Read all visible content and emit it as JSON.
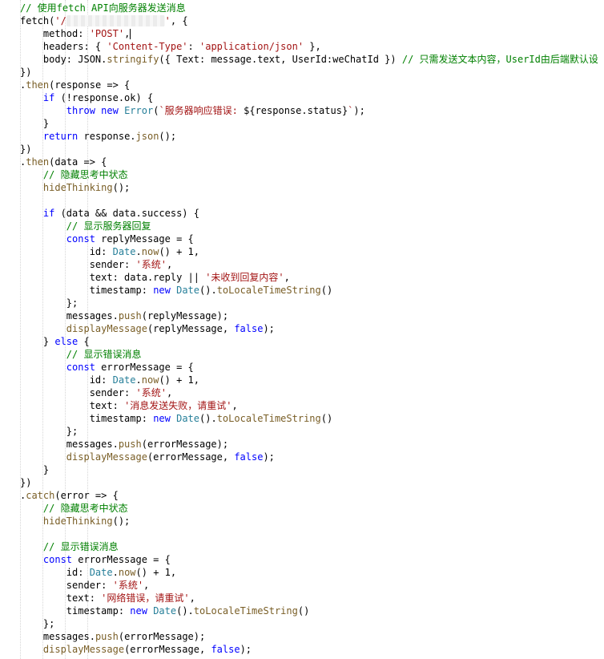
{
  "editor": {
    "colors": {
      "background": "#ffffff",
      "comment": "#008000",
      "keyword": "#0000ff",
      "string": "#a31515",
      "builtin": "#267f99",
      "function": "#795e26",
      "plain": "#000000"
    },
    "cursor_line": 3,
    "lines": [
      {
        "indent": 0,
        "tokens": [
          {
            "t": "comment",
            "s": "// 使用fetch API向服务器发送消息"
          }
        ]
      },
      {
        "indent": 0,
        "tokens": [
          {
            "t": "plain",
            "s": "fetch("
          },
          {
            "t": "string",
            "s": "'/"
          },
          {
            "t": "redacted",
            "s": "xxxxxxxxxxxxxxxxx"
          },
          {
            "t": "string",
            "s": "'"
          },
          {
            "t": "plain",
            "s": ", {"
          }
        ]
      },
      {
        "indent": 1,
        "tokens": [
          {
            "t": "plain",
            "s": "method: "
          },
          {
            "t": "string",
            "s": "'POST'"
          },
          {
            "t": "plain",
            "s": ","
          }
        ]
      },
      {
        "indent": 1,
        "tokens": [
          {
            "t": "plain",
            "s": "headers: { "
          },
          {
            "t": "string",
            "s": "'Content-Type'"
          },
          {
            "t": "plain",
            "s": ": "
          },
          {
            "t": "string",
            "s": "'application/json'"
          },
          {
            "t": "plain",
            "s": " },"
          }
        ]
      },
      {
        "indent": 1,
        "tokens": [
          {
            "t": "plain",
            "s": "body: JSON."
          },
          {
            "t": "func",
            "s": "stringify"
          },
          {
            "t": "plain",
            "s": "({ Text: message.text, UserId:weChatId }) "
          },
          {
            "t": "comment",
            "s": "// 只需发送文本内容，UserId由后端默认设"
          }
        ]
      },
      {
        "indent": 0,
        "tokens": [
          {
            "t": "plain",
            "s": "})"
          }
        ]
      },
      {
        "indent": 0,
        "tokens": [
          {
            "t": "plain",
            "s": "."
          },
          {
            "t": "func",
            "s": "then"
          },
          {
            "t": "plain",
            "s": "(response => {"
          }
        ]
      },
      {
        "indent": 1,
        "tokens": [
          {
            "t": "keyword",
            "s": "if"
          },
          {
            "t": "plain",
            "s": " (!response.ok) {"
          }
        ]
      },
      {
        "indent": 2,
        "tokens": [
          {
            "t": "keyword",
            "s": "throw"
          },
          {
            "t": "plain",
            "s": " "
          },
          {
            "t": "keyword",
            "s": "new"
          },
          {
            "t": "plain",
            "s": " "
          },
          {
            "t": "builtin",
            "s": "Error"
          },
          {
            "t": "plain",
            "s": "("
          },
          {
            "t": "string",
            "s": "`服务器响应错误: "
          },
          {
            "t": "plain",
            "s": "${response.status}"
          },
          {
            "t": "string",
            "s": "`"
          },
          {
            "t": "plain",
            "s": ");"
          }
        ]
      },
      {
        "indent": 1,
        "tokens": [
          {
            "t": "plain",
            "s": "}"
          }
        ]
      },
      {
        "indent": 1,
        "tokens": [
          {
            "t": "keyword",
            "s": "return"
          },
          {
            "t": "plain",
            "s": " response."
          },
          {
            "t": "func",
            "s": "json"
          },
          {
            "t": "plain",
            "s": "();"
          }
        ]
      },
      {
        "indent": 0,
        "tokens": [
          {
            "t": "plain",
            "s": "})"
          }
        ]
      },
      {
        "indent": 0,
        "tokens": [
          {
            "t": "plain",
            "s": "."
          },
          {
            "t": "func",
            "s": "then"
          },
          {
            "t": "plain",
            "s": "(data => {"
          }
        ]
      },
      {
        "indent": 1,
        "tokens": [
          {
            "t": "comment",
            "s": "// 隐藏思考中状态"
          }
        ]
      },
      {
        "indent": 1,
        "tokens": [
          {
            "t": "func",
            "s": "hideThinking"
          },
          {
            "t": "plain",
            "s": "();"
          }
        ]
      },
      {
        "indent": 0,
        "tokens": []
      },
      {
        "indent": 1,
        "tokens": [
          {
            "t": "keyword",
            "s": "if"
          },
          {
            "t": "plain",
            "s": " (data && data.success) {"
          }
        ]
      },
      {
        "indent": 2,
        "tokens": [
          {
            "t": "comment",
            "s": "// 显示服务器回复"
          }
        ]
      },
      {
        "indent": 2,
        "tokens": [
          {
            "t": "keyword",
            "s": "const"
          },
          {
            "t": "plain",
            "s": " replyMessage = {"
          }
        ]
      },
      {
        "indent": 3,
        "tokens": [
          {
            "t": "plain",
            "s": "id: "
          },
          {
            "t": "builtin",
            "s": "Date"
          },
          {
            "t": "plain",
            "s": "."
          },
          {
            "t": "func",
            "s": "now"
          },
          {
            "t": "plain",
            "s": "() + 1,"
          }
        ]
      },
      {
        "indent": 3,
        "tokens": [
          {
            "t": "plain",
            "s": "sender: "
          },
          {
            "t": "string",
            "s": "'系统'"
          },
          {
            "t": "plain",
            "s": ","
          }
        ]
      },
      {
        "indent": 3,
        "tokens": [
          {
            "t": "plain",
            "s": "text: data.reply || "
          },
          {
            "t": "string",
            "s": "'未收到回复内容'"
          },
          {
            "t": "plain",
            "s": ","
          }
        ]
      },
      {
        "indent": 3,
        "tokens": [
          {
            "t": "plain",
            "s": "timestamp: "
          },
          {
            "t": "keyword",
            "s": "new"
          },
          {
            "t": "plain",
            "s": " "
          },
          {
            "t": "builtin",
            "s": "Date"
          },
          {
            "t": "plain",
            "s": "()."
          },
          {
            "t": "func",
            "s": "toLocaleTimeString"
          },
          {
            "t": "plain",
            "s": "()"
          }
        ]
      },
      {
        "indent": 2,
        "tokens": [
          {
            "t": "plain",
            "s": "};"
          }
        ]
      },
      {
        "indent": 2,
        "tokens": [
          {
            "t": "plain",
            "s": "messages."
          },
          {
            "t": "func",
            "s": "push"
          },
          {
            "t": "plain",
            "s": "(replyMessage);"
          }
        ]
      },
      {
        "indent": 2,
        "tokens": [
          {
            "t": "func",
            "s": "displayMessage"
          },
          {
            "t": "plain",
            "s": "(replyMessage, "
          },
          {
            "t": "keyword",
            "s": "false"
          },
          {
            "t": "plain",
            "s": ");"
          }
        ]
      },
      {
        "indent": 1,
        "tokens": [
          {
            "t": "plain",
            "s": "} "
          },
          {
            "t": "keyword",
            "s": "else"
          },
          {
            "t": "plain",
            "s": " {"
          }
        ]
      },
      {
        "indent": 2,
        "tokens": [
          {
            "t": "comment",
            "s": "// 显示错误消息"
          }
        ]
      },
      {
        "indent": 2,
        "tokens": [
          {
            "t": "keyword",
            "s": "const"
          },
          {
            "t": "plain",
            "s": " errorMessage = {"
          }
        ]
      },
      {
        "indent": 3,
        "tokens": [
          {
            "t": "plain",
            "s": "id: "
          },
          {
            "t": "builtin",
            "s": "Date"
          },
          {
            "t": "plain",
            "s": "."
          },
          {
            "t": "func",
            "s": "now"
          },
          {
            "t": "plain",
            "s": "() + 1,"
          }
        ]
      },
      {
        "indent": 3,
        "tokens": [
          {
            "t": "plain",
            "s": "sender: "
          },
          {
            "t": "string",
            "s": "'系统'"
          },
          {
            "t": "plain",
            "s": ","
          }
        ]
      },
      {
        "indent": 3,
        "tokens": [
          {
            "t": "plain",
            "s": "text: "
          },
          {
            "t": "string",
            "s": "'消息发送失败，请重试'"
          },
          {
            "t": "plain",
            "s": ","
          }
        ]
      },
      {
        "indent": 3,
        "tokens": [
          {
            "t": "plain",
            "s": "timestamp: "
          },
          {
            "t": "keyword",
            "s": "new"
          },
          {
            "t": "plain",
            "s": " "
          },
          {
            "t": "builtin",
            "s": "Date"
          },
          {
            "t": "plain",
            "s": "()."
          },
          {
            "t": "func",
            "s": "toLocaleTimeString"
          },
          {
            "t": "plain",
            "s": "()"
          }
        ]
      },
      {
        "indent": 2,
        "tokens": [
          {
            "t": "plain",
            "s": "};"
          }
        ]
      },
      {
        "indent": 2,
        "tokens": [
          {
            "t": "plain",
            "s": "messages."
          },
          {
            "t": "func",
            "s": "push"
          },
          {
            "t": "plain",
            "s": "(errorMessage);"
          }
        ]
      },
      {
        "indent": 2,
        "tokens": [
          {
            "t": "func",
            "s": "displayMessage"
          },
          {
            "t": "plain",
            "s": "(errorMessage, "
          },
          {
            "t": "keyword",
            "s": "false"
          },
          {
            "t": "plain",
            "s": ");"
          }
        ]
      },
      {
        "indent": 1,
        "tokens": [
          {
            "t": "plain",
            "s": "}"
          }
        ]
      },
      {
        "indent": 0,
        "tokens": [
          {
            "t": "plain",
            "s": "})"
          }
        ]
      },
      {
        "indent": 0,
        "tokens": [
          {
            "t": "plain",
            "s": "."
          },
          {
            "t": "func",
            "s": "catch"
          },
          {
            "t": "plain",
            "s": "(error => {"
          }
        ]
      },
      {
        "indent": 1,
        "tokens": [
          {
            "t": "comment",
            "s": "// 隐藏思考中状态"
          }
        ]
      },
      {
        "indent": 1,
        "tokens": [
          {
            "t": "func",
            "s": "hideThinking"
          },
          {
            "t": "plain",
            "s": "();"
          }
        ]
      },
      {
        "indent": 0,
        "tokens": []
      },
      {
        "indent": 1,
        "tokens": [
          {
            "t": "comment",
            "s": "// 显示错误消息"
          }
        ]
      },
      {
        "indent": 1,
        "tokens": [
          {
            "t": "keyword",
            "s": "const"
          },
          {
            "t": "plain",
            "s": " errorMessage = {"
          }
        ]
      },
      {
        "indent": 2,
        "tokens": [
          {
            "t": "plain",
            "s": "id: "
          },
          {
            "t": "builtin",
            "s": "Date"
          },
          {
            "t": "plain",
            "s": "."
          },
          {
            "t": "func",
            "s": "now"
          },
          {
            "t": "plain",
            "s": "() + 1,"
          }
        ]
      },
      {
        "indent": 2,
        "tokens": [
          {
            "t": "plain",
            "s": "sender: "
          },
          {
            "t": "string",
            "s": "'系统'"
          },
          {
            "t": "plain",
            "s": ","
          }
        ]
      },
      {
        "indent": 2,
        "tokens": [
          {
            "t": "plain",
            "s": "text: "
          },
          {
            "t": "string",
            "s": "'网络错误，请重试'"
          },
          {
            "t": "plain",
            "s": ","
          }
        ]
      },
      {
        "indent": 2,
        "tokens": [
          {
            "t": "plain",
            "s": "timestamp: "
          },
          {
            "t": "keyword",
            "s": "new"
          },
          {
            "t": "plain",
            "s": " "
          },
          {
            "t": "builtin",
            "s": "Date"
          },
          {
            "t": "plain",
            "s": "()."
          },
          {
            "t": "func",
            "s": "toLocaleTimeString"
          },
          {
            "t": "plain",
            "s": "()"
          }
        ]
      },
      {
        "indent": 1,
        "tokens": [
          {
            "t": "plain",
            "s": "};"
          }
        ]
      },
      {
        "indent": 1,
        "tokens": [
          {
            "t": "plain",
            "s": "messages."
          },
          {
            "t": "func",
            "s": "push"
          },
          {
            "t": "plain",
            "s": "(errorMessage);"
          }
        ]
      },
      {
        "indent": 1,
        "tokens": [
          {
            "t": "func",
            "s": "displayMessage"
          },
          {
            "t": "plain",
            "s": "(errorMessage, "
          },
          {
            "t": "keyword",
            "s": "false"
          },
          {
            "t": "plain",
            "s": ");"
          }
        ]
      }
    ]
  }
}
